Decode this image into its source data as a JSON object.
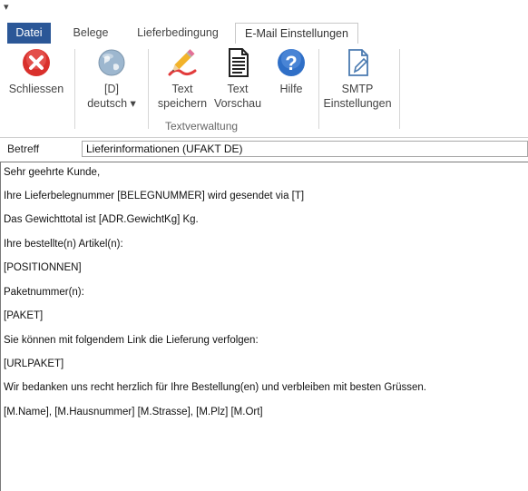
{
  "quick_access": {
    "glyph": "▾"
  },
  "tabs": [
    {
      "label": "Datei"
    },
    {
      "label": "Belege"
    },
    {
      "label": "Lieferbedingung"
    },
    {
      "label": "E-Mail Einstellungen"
    }
  ],
  "ribbon": {
    "close": {
      "label": "Schliessen",
      "icon": "close-icon"
    },
    "language": {
      "line1": "[D]",
      "line2": "deutsch ▾",
      "icon": "globe-icon"
    },
    "save_text": {
      "line1": "Text",
      "line2": "speichern",
      "icon": "pencil-edit-icon"
    },
    "preview_text": {
      "line1": "Text",
      "line2": "Vorschau",
      "icon": "document-icon"
    },
    "help": {
      "label": "Hilfe",
      "icon": "help-icon"
    },
    "smtp": {
      "line1": "SMTP",
      "line2": "Einstellungen",
      "icon": "settings-document-icon"
    },
    "group_label": "Textverwaltung"
  },
  "subject": {
    "label": "Betreff",
    "value": "Lieferinformationen (UFAKT DE)"
  },
  "body_lines": [
    "Sehr geehrte Kunde,",
    "Ihre Lieferbelegnummer [BELEGNUMMER] wird gesendet via [T]",
    "Das Gewichttotal ist [ADR.GewichtKg] Kg.",
    "Ihre bestellte(n) Artikel(n):",
    "[POSITIONNEN]",
    "Paketnummer(n):",
    "[PAKET]",
    "Sie können mit folgendem Link die Lieferung verfolgen:",
    "[URLPAKET]",
    "Wir bedanken uns recht herzlich für Ihre Bestellung(en) und verbleiben mit besten Grüssen.",
    "[M.Name], [M.Hausnummer] [M.Strasse], [M.Plz] [M.Ort]"
  ],
  "colors": {
    "file_tab": "#2b5797",
    "close_red": "#d9302c",
    "help_blue": "#2f6fc7"
  }
}
